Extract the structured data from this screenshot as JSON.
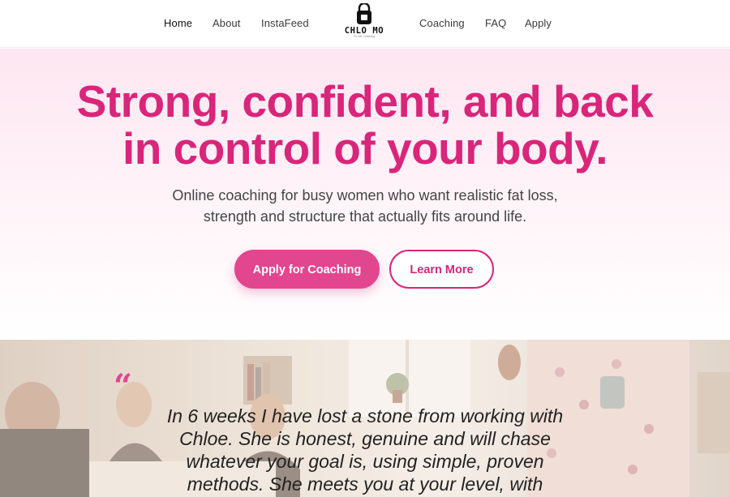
{
  "nav": {
    "items_left": [
      "Home",
      "About",
      "InstaFeed"
    ],
    "items_right": [
      "Coaching",
      "FAQ",
      "Apply"
    ],
    "logo": {
      "icon": "kettlebell-icon",
      "title": "CHLO MO",
      "tagline": "Fit Life Coaching"
    }
  },
  "hero": {
    "headline_line1": "Strong, confident, and back",
    "headline_line2": "in control of your body.",
    "subtitle_line1": "Online coaching for busy women who want realistic fat loss,",
    "subtitle_line2": "strength and structure that actually fits around life.",
    "primary_cta": "Apply for Coaching",
    "secondary_cta": "Learn More"
  },
  "testimonial": {
    "quote_mark": "“",
    "line1": "In 6 weeks I have lost a stone from working with",
    "line2": "Chloe. She is honest, genuine and will chase",
    "line3": "whatever your goal is, using simple, proven",
    "line4": "methods. She meets you at your level, with"
  },
  "colors": {
    "accent": "#d9257a",
    "accent_button": "#e2468f",
    "hero_background": "#fde6f1"
  }
}
